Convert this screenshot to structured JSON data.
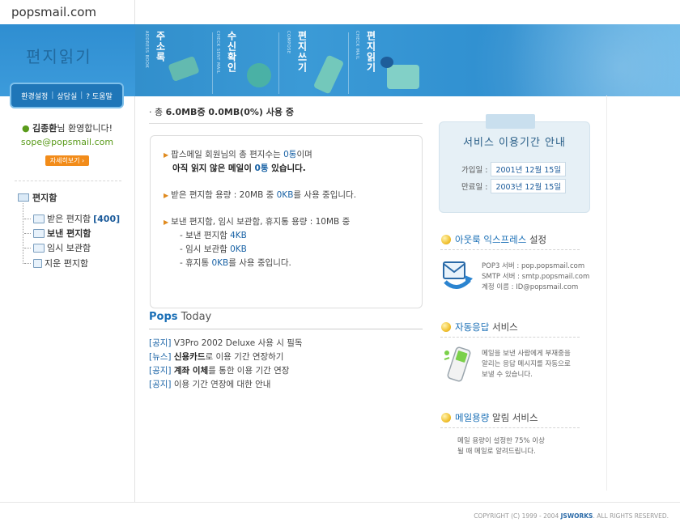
{
  "logo": "popsmail.com",
  "banner": {
    "title": "편지읽기",
    "menu": [
      {
        "label": "주소록",
        "sub": "ADDRESS BOOK"
      },
      {
        "label": "수신확인",
        "sub": "CHECK SENT MAIL"
      },
      {
        "label": "편지쓰기",
        "sub": "COMPOSE"
      },
      {
        "label": "편지읽기",
        "sub": "CHECK MAIL"
      }
    ]
  },
  "util": {
    "settings": "환경설정",
    "support": "상담실",
    "help": "? 도움말"
  },
  "user": {
    "name": "김종환",
    "greeting": "님 환영합니다!",
    "email": "sope@popsmail.com",
    "detail_button": "자세히보기 ›"
  },
  "folders": {
    "root": "편지함",
    "items": [
      {
        "label": "받은 편지함",
        "count": "[400]",
        "bold": false
      },
      {
        "label": "보낸 편지함",
        "count": "",
        "bold": true
      },
      {
        "label": "임시 보관함",
        "count": "",
        "bold": false
      },
      {
        "label": "지운 편지함",
        "count": "",
        "bold": false
      }
    ]
  },
  "usage": {
    "prefix": "· 총 ",
    "text": "6.0MB중 0.0MB(0%) 사용 중"
  },
  "info": {
    "p1_a": "팝스메일 회원님의 총 편지수는 ",
    "p1_count": "0통",
    "p1_b": "이며",
    "p1_c": "아직 읽지 않은 메일이 ",
    "p1_unread": "0통",
    "p1_d": " 있습니다.",
    "p2_a": "받은 편지함 용량 : 20MB 중 ",
    "p2_val": "0KB",
    "p2_b": "를 사용 중입니다.",
    "p3_a": "보낸 편지함, 임시 보관함, 휴지통 용량 : 10MB 중",
    "p3_l1a": "- 보낸 편지함 ",
    "p3_l1v": "4KB",
    "p3_l2a": "- 임시 보관함 ",
    "p3_l2v": "0KB",
    "p3_l3a": "- 휴지통 ",
    "p3_l3v": "0KB",
    "p3_l3b": "를 사용 중입니다."
  },
  "pops_today": {
    "brand": "Pops",
    "title": " Today"
  },
  "news": [
    {
      "tag": "[공지]",
      "pre": " V3Pro 2002 Deluxe 사용 시 필독",
      "bold": "",
      "post": ""
    },
    {
      "tag": "[뉴스]",
      "pre": " ",
      "bold": "신용카드",
      "post": "로 이용 기간 연장하기"
    },
    {
      "tag": "[공지]",
      "pre": " ",
      "bold": "계좌 이체",
      "post": "를 통한 이용 기간 연장"
    },
    {
      "tag": "[공지]",
      "pre": " 이용 기간 연장에 대한 안내",
      "bold": "",
      "post": ""
    }
  ],
  "service_period": {
    "title": "서비스 이용기간 안내",
    "join_label": "가입일 :",
    "join_date": "2001년 12월 15일",
    "end_label": "만료일 :",
    "end_date": "2003년 12월 15일"
  },
  "outlook": {
    "title_em": "아웃룩 익스프레스",
    "title_rest": " 설정",
    "pop3": "POP3 서버 : pop.popsmail.com",
    "smtp": "SMTP 서버 : smtp.popsmail.com",
    "account": "계정 이름 : ID@popsmail.com"
  },
  "autoreply": {
    "title_em": "자동응답",
    "title_rest": " 서비스",
    "line1": "메일을 보낸 사람에게 부재중을",
    "line2": "알리는 응답 메시지를 자동으로",
    "line3": "보낼 수 있습니다."
  },
  "capacity_alert": {
    "title_em": "메일용량",
    "title_rest": " 알림 서비스",
    "line1": "메일 용량이 설정한 75% 이상",
    "line2": "될 때 메일로 알려드립니다."
  },
  "footer": {
    "prefix": "COPYRIGHT (C) 1999 - 2004 ",
    "brand": "JSWORKS",
    "suffix": ". ALL RIGHTS RESERVED."
  },
  "colors": {
    "accent": "#1a6fb6",
    "banner": "#2f8fd0",
    "orange": "#f28c1a",
    "email_green": "#5a9b1b"
  }
}
